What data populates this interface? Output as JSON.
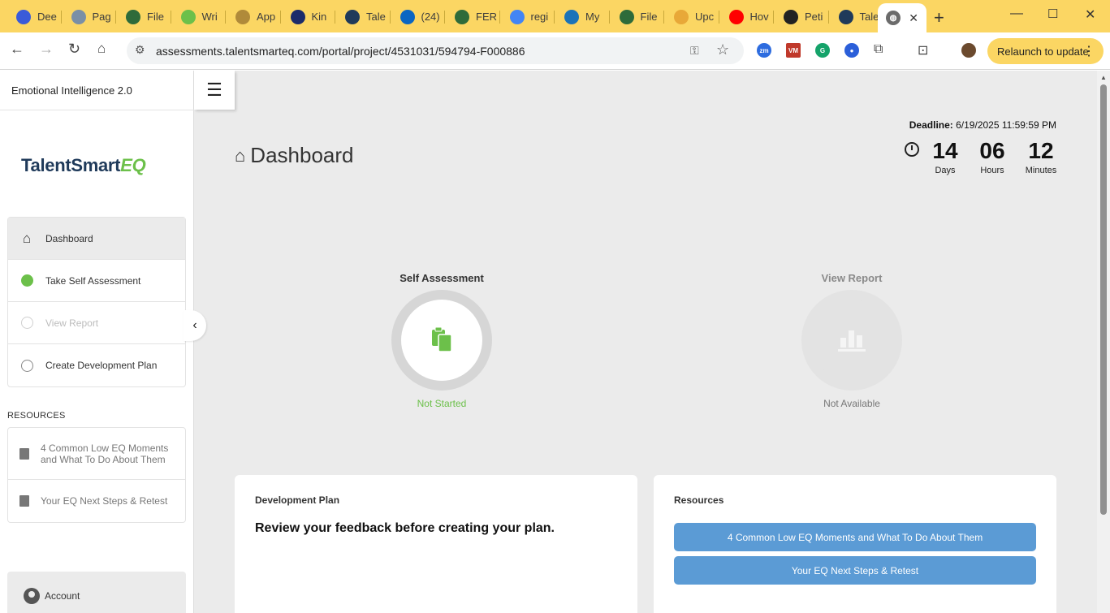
{
  "browser": {
    "tabs": [
      {
        "label": "Dee",
        "icon": "vivaldi-icon",
        "color": "#3a5bd9"
      },
      {
        "label": "Pag",
        "icon": "globe-icon",
        "color": "#7a8fa6"
      },
      {
        "label": "File",
        "icon": "seal-icon",
        "color": "#2e6b3a"
      },
      {
        "label": "Wri",
        "icon": "play-icon",
        "color": "#6cc04a"
      },
      {
        "label": "App",
        "icon": "cloud-icon",
        "color": "#b08a3a"
      },
      {
        "label": "Kin",
        "icon": "k-icon",
        "color": "#1b2b6a"
      },
      {
        "label": "Tale",
        "icon": "ts-icon",
        "color": "#1f3a5a"
      },
      {
        "label": "(24)",
        "icon": "linkedin-icon",
        "color": "#0a66c2"
      },
      {
        "label": "FER",
        "icon": "seal-icon",
        "color": "#2e6b3a"
      },
      {
        "label": "regi",
        "icon": "google-icon",
        "color": "#4285f4"
      },
      {
        "label": "My",
        "icon": "dell-icon",
        "color": "#1a73b8"
      },
      {
        "label": "File",
        "icon": "seal-icon",
        "color": "#2e6b3a"
      },
      {
        "label": "Upc",
        "icon": "pinwheel-icon",
        "color": "#e8a838"
      },
      {
        "label": "Hov",
        "icon": "youtube-icon",
        "color": "#ff0000"
      },
      {
        "label": "Peti",
        "icon": "openai-icon",
        "color": "#222222"
      },
      {
        "label": "Tale",
        "icon": "ts-icon",
        "color": "#1f3a5a"
      }
    ],
    "active_tab": {
      "label": "",
      "icon": "globe-icon"
    },
    "url": "assessments.talentsmarteq.com/portal/project/4531031/594794-F000886",
    "relaunch_label": "Relaunch to update",
    "ext_zoom": "zm",
    "ext_vm": "VM"
  },
  "app": {
    "title": "Emotional Intelligence 2.0",
    "logo_text": "TalentSmart",
    "logo_suffix": "EQ"
  },
  "sidebar": {
    "nav": [
      {
        "label": "Dashboard",
        "state": "active"
      },
      {
        "label": "Take Self Assessment",
        "state": "started"
      },
      {
        "label": "View Report",
        "state": "disabled"
      },
      {
        "label": "Create Development Plan",
        "state": "pending"
      }
    ],
    "resources_header": "RESOURCES",
    "resources": [
      {
        "label": "4 Common Low EQ Moments and What To Do About Them"
      },
      {
        "label": "Your EQ Next Steps & Retest"
      }
    ],
    "account_label": "Account"
  },
  "main": {
    "title": "Dashboard",
    "deadline_label": "Deadline:",
    "deadline_value": "6/19/2025 11:59:59 PM",
    "countdown": [
      {
        "value": "14",
        "label": "Days"
      },
      {
        "value": "06",
        "label": "Hours"
      },
      {
        "value": "12",
        "label": "Minutes"
      }
    ],
    "steps": [
      {
        "title": "Self Assessment",
        "status": "Not Started",
        "icon": "clipboard-icon"
      },
      {
        "title": "View Report",
        "status": "Not Available",
        "icon": "bar-chart-icon"
      }
    ],
    "dev_plan": {
      "title": "Development Plan",
      "message": "Review your feedback before creating your plan."
    },
    "resources_card": {
      "title": "Resources",
      "buttons": [
        "4 Common Low EQ Moments and What To Do About Them",
        "Your EQ Next Steps & Retest"
      ]
    }
  },
  "colors": {
    "accent_green": "#6cc04a",
    "button_blue": "#5b9bd5",
    "brand_navy": "#1f3a5a",
    "chrome_yellow": "#fbd663"
  }
}
